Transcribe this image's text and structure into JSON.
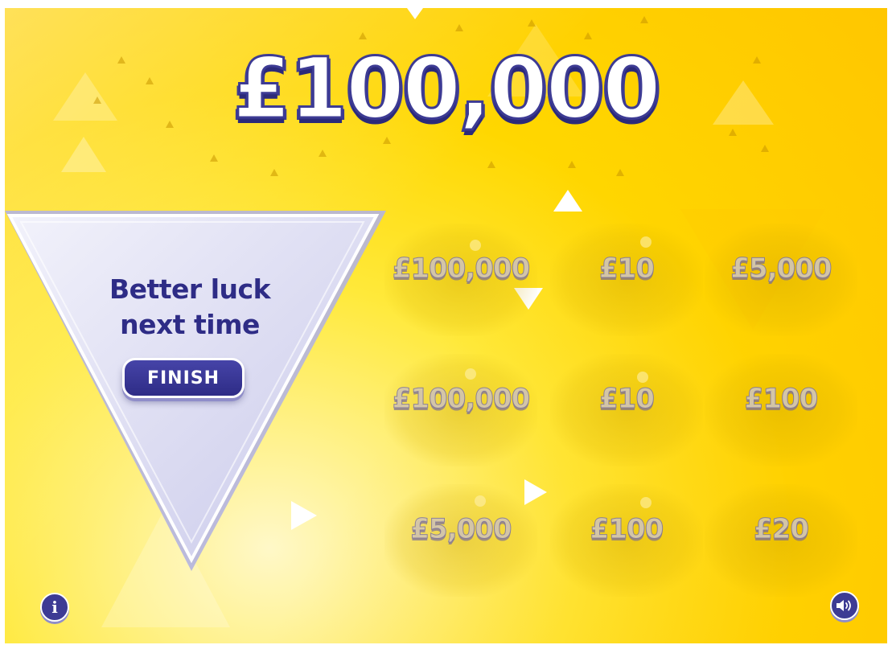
{
  "game": {
    "jackpot_title": "£100,000"
  },
  "result": {
    "line1": "Better luck",
    "line2": "next time",
    "finish_label": "FINISH"
  },
  "grid": {
    "cells": [
      "£100,000",
      "£10",
      "£5,000",
      "£100,000",
      "£10",
      "£100",
      "£5,000",
      "£100",
      "£20"
    ]
  },
  "controls": {
    "info_icon": "info-icon",
    "sound_icon": "speaker-icon"
  },
  "colors": {
    "primary": "#3d3b94",
    "background": "#ffd700",
    "panel": "#e4e4f6"
  }
}
